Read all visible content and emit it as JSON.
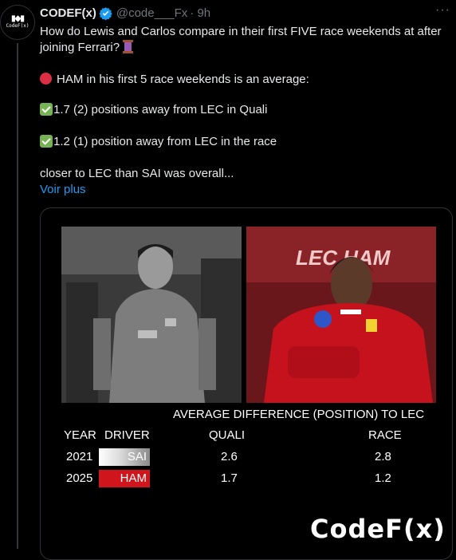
{
  "author": {
    "name": "CODEF(x)",
    "handle": "@code___Fx",
    "time": "· 9h",
    "avatar_text": "CodeF(x)"
  },
  "tweet": {
    "line1": "How do Lewis and Carlos compare in their first FIVE race weekends at after joining Ferrari?",
    "line2": "HAM in his first 5 race weekends is an average:",
    "line3": "1.7 (2) positions away from LEC in Quali",
    "line4": "1.2 (1) position away from LEC in the race",
    "line5": "closer to LEC than SAI was overall...",
    "see_more": "Voir plus"
  },
  "card": {
    "title": "AVERAGE DIFFERENCE (POSITION)  TO LEC",
    "headers": {
      "year": "YEAR",
      "driver": "DRIVER",
      "quali": "QUALI",
      "race": "RACE"
    },
    "rows": [
      {
        "year": "2021",
        "driver": "SAI",
        "quali": "2.6",
        "race": "2.8"
      },
      {
        "year": "2025",
        "driver": "HAM",
        "quali": "1.7",
        "race": "1.2"
      }
    ],
    "logo": "CodeF(x)",
    "photo_left_text": "",
    "photo_right_text": "LEC HAM"
  },
  "colors": {
    "background": "#000000",
    "text": "#e7e9ea",
    "muted": "#71767b",
    "link": "#1d9bf0",
    "verified": "#1d9bf0",
    "ham_red": "#d0161c"
  },
  "icons": [
    "verified-badge-icon",
    "more-icon",
    "thread-spool-icon",
    "red-circle-icon",
    "check-mark-icon"
  ]
}
